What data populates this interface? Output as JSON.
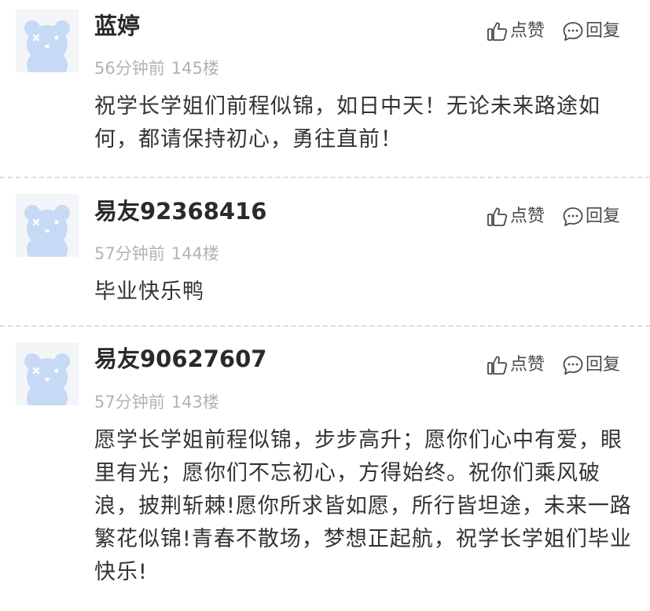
{
  "labels": {
    "like": "点赞",
    "reply": "回复"
  },
  "colors": {
    "avatar_bg": "#f3f5f8",
    "avatar_bear": "#c6daf5",
    "meta_text": "#b3b3b3",
    "divider": "#dedede"
  },
  "comments": [
    {
      "username": "蓝婷",
      "time": "56分钟前",
      "floor": "145楼",
      "text": "祝学长学姐们前程似锦，如日中天！无论未来路途如何，都请保持初心，勇往直前！"
    },
    {
      "username": "易友92368416",
      "time": "57分钟前",
      "floor": "144楼",
      "text": "毕业快乐鸭"
    },
    {
      "username": "易友90627607",
      "time": "57分钟前",
      "floor": "143楼",
      "text": "愿学长学姐前程似锦，步步高升；愿你们心中有爱，眼里有光；愿你们不忘初心，方得始终。祝你们乘风破浪，披荆斩棘!愿你所求皆如愿，所行皆坦途，未来一路繁花似锦!青春不散场，梦想正起航，祝学长学姐们毕业快乐!"
    }
  ]
}
